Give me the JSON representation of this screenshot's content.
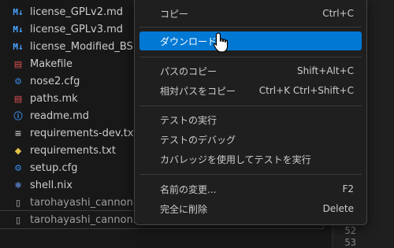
{
  "explorer": {
    "files": [
      {
        "name": "license_GPLv2.md",
        "icon": "markdown-icon",
        "glyph": "M↓"
      },
      {
        "name": "license_GPLv3.md",
        "icon": "markdown-icon",
        "glyph": "M↓"
      },
      {
        "name": "license_Modified_BSD.md",
        "icon": "markdown-icon",
        "glyph": "M↓"
      },
      {
        "name": "Makefile",
        "icon": "makefile-icon",
        "glyph": "▤"
      },
      {
        "name": "nose2.cfg",
        "icon": "gear-icon",
        "glyph": "⚙"
      },
      {
        "name": "paths.mk",
        "icon": "makefile-icon",
        "glyph": "▤"
      },
      {
        "name": "readme.md",
        "icon": "info-icon",
        "glyph": "ⓘ"
      },
      {
        "name": "requirements-dev.txt",
        "icon": "text-file-icon",
        "glyph": "≡"
      },
      {
        "name": "requirements.txt",
        "icon": "python-icon",
        "glyph": "◆"
      },
      {
        "name": "setup.cfg",
        "icon": "gear-icon",
        "glyph": "⚙"
      },
      {
        "name": "shell.nix",
        "icon": "nix-icon",
        "glyph": "❄"
      },
      {
        "name": "tarohayashi_cannonball",
        "icon": "file-icon",
        "glyph": "▯"
      },
      {
        "name": "tarohayashi_cannonball",
        "icon": "file-icon",
        "glyph": "▯"
      }
    ]
  },
  "editor": {
    "line_numbers": [
      "52",
      "53"
    ]
  },
  "context_menu": {
    "items": [
      {
        "label": "コピー",
        "shortcut": "Ctrl+C"
      },
      {
        "label": "ダウンロード...",
        "shortcut": ""
      },
      {
        "label": "パスのコピー",
        "shortcut": "Shift+Alt+C"
      },
      {
        "label": "相対パスをコピー",
        "shortcut": "Ctrl+K Ctrl+Shift+C"
      },
      {
        "label": "テストの実行",
        "shortcut": ""
      },
      {
        "label": "テストのデバッグ",
        "shortcut": ""
      },
      {
        "label": "カバレッジを使用してテストを実行",
        "shortcut": ""
      },
      {
        "label": "名前の変更...",
        "shortcut": "F2"
      },
      {
        "label": "完全に削除",
        "shortcut": "Delete"
      }
    ]
  },
  "colors": {
    "highlight": "#0078d4",
    "background": "#1f1f1f"
  }
}
